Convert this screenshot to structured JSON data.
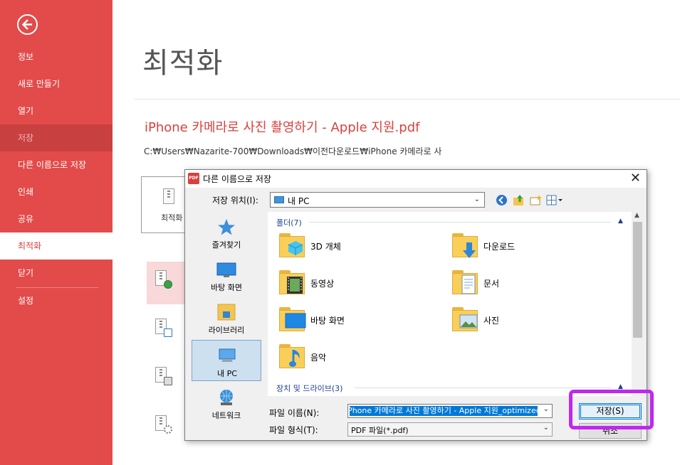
{
  "sidebar": {
    "items": [
      {
        "label": "정보"
      },
      {
        "label": "새로 만들기"
      },
      {
        "label": "열기"
      },
      {
        "label": "저장"
      },
      {
        "label": "다른 이름으로 저장"
      },
      {
        "label": "인쇄"
      },
      {
        "label": "공유"
      },
      {
        "label": "최적화"
      },
      {
        "label": "닫기"
      },
      {
        "label": "설정"
      }
    ],
    "active": "최적화",
    "disabled": "저장"
  },
  "main": {
    "title": "최적화",
    "doc_name": "iPhone 카메라로 사진 촬영하기 - Apple 지원.pdf",
    "doc_path": "C:₩Users₩Nazarite-700₩Downloads₩이전다운로드₩iPhone 카메라로 사",
    "optimize_box_label": "최적화"
  },
  "dialog": {
    "title": "다른 이름으로 저장",
    "close": "✕",
    "location_label": "저장 위치(I):",
    "location_value": "내 PC",
    "places": [
      {
        "label": "즐겨찾기",
        "icon": "star-icon"
      },
      {
        "label": "바탕 화면",
        "icon": "desktop-icon"
      },
      {
        "label": "라이브러리",
        "icon": "library-icon"
      },
      {
        "label": "내 PC",
        "icon": "pc-icon"
      },
      {
        "label": "네트워크",
        "icon": "network-icon"
      }
    ],
    "groups": {
      "folders": "폴더(7)",
      "drives": "장치 및 드라이브(3)"
    },
    "folders": [
      {
        "name": "3D 개체"
      },
      {
        "name": "다운로드"
      },
      {
        "name": "동영상"
      },
      {
        "name": "문서"
      },
      {
        "name": "바탕 화면"
      },
      {
        "name": "사진"
      },
      {
        "name": "음악"
      }
    ],
    "filename_label": "파일 이름(N):",
    "filename_value": "iPhone 카메라로 사진 촬영하기 - Apple 지원_optimized",
    "filetype_label": "파일 형식(T):",
    "filetype_value": "PDF 파일(*.pdf)",
    "save_label": "저장(S)",
    "cancel_label": "취소"
  },
  "colors": {
    "sidebar": "#e24b4a",
    "accent": "#d9413e",
    "highlight": "#c027f0",
    "selection": "#0078d7"
  }
}
